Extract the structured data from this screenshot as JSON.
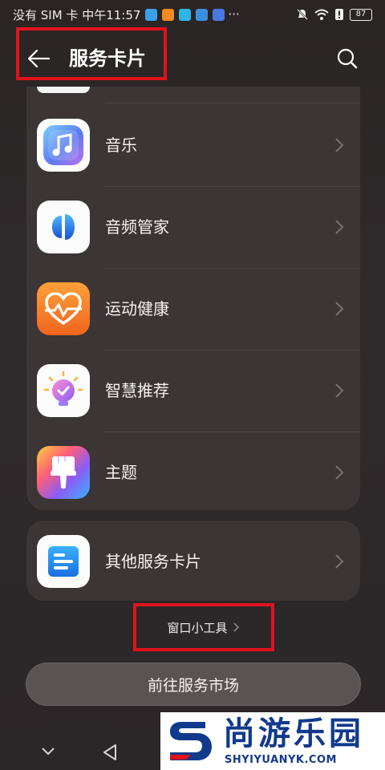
{
  "status_bar": {
    "left_text": "没有 SIM 卡 中午11:57",
    "more": "···",
    "battery": "87",
    "app_icon_colors": [
      "#3aa0e8",
      "#f08a1c",
      "#2fb5e8",
      "#3c8fe0",
      "#4a78e0"
    ]
  },
  "header": {
    "title": "服务卡片",
    "back_icon": "arrow-left-icon",
    "search_icon": "search-icon"
  },
  "services": [
    {
      "label": "音乐",
      "icon": "music-note-icon"
    },
    {
      "label": "音频管家",
      "icon": "audio-manager-icon"
    },
    {
      "label": "运动健康",
      "icon": "health-heart-icon"
    },
    {
      "label": "智慧推荐",
      "icon": "lightbulb-check-icon"
    },
    {
      "label": "主题",
      "icon": "paintbrush-icon"
    }
  ],
  "other": {
    "label": "其他服务卡片",
    "icon": "document-icon"
  },
  "widget_link": {
    "label": "窗口小工具"
  },
  "market_button": {
    "label": "前往服务市场"
  },
  "watermark": {
    "brand": "尚游乐园",
    "url": "SHYIYUANYK.COM"
  },
  "colors": {
    "highlight": "#e0121b",
    "card": "#3b3536",
    "brand_blue": "#123a8c"
  }
}
